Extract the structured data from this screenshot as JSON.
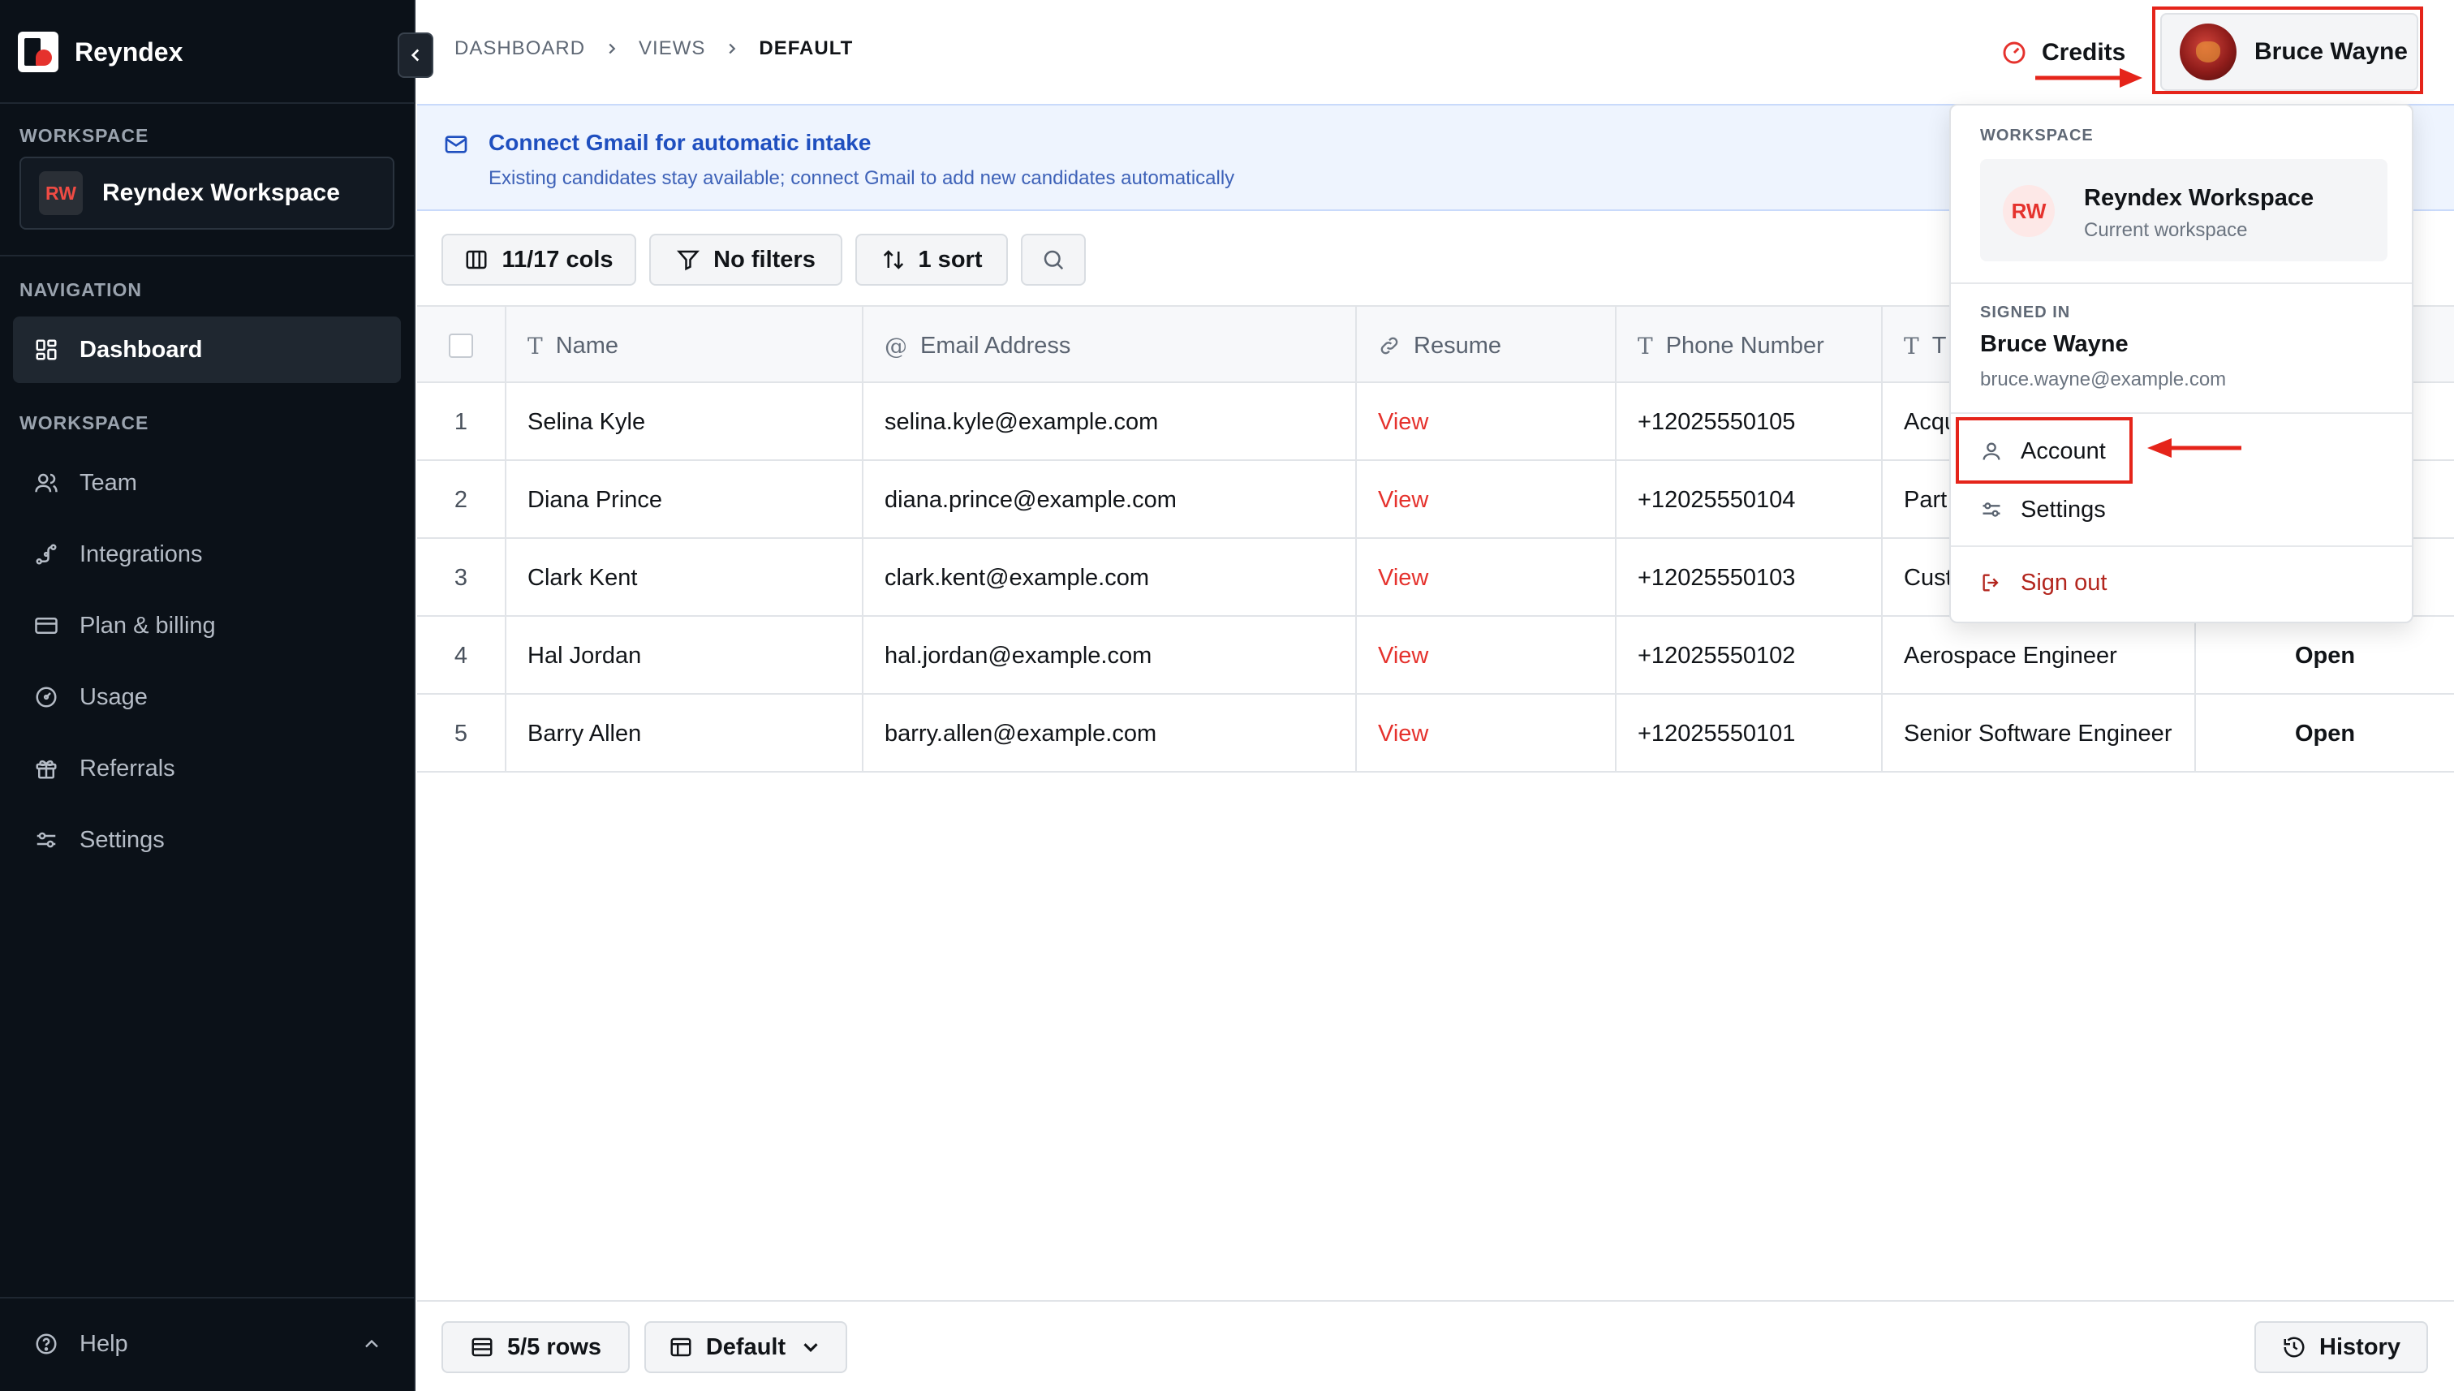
{
  "app": {
    "name": "Reyndex"
  },
  "sidebar": {
    "workspace_section": "WORKSPACE",
    "workspace": {
      "initials": "RW",
      "name": "Reyndex Workspace"
    },
    "navigation_section": "NAVIGATION",
    "workspace_nav_section": "WORKSPACE",
    "items": [
      {
        "label": "Dashboard",
        "icon": "dashboard-icon",
        "active": true
      },
      {
        "label": "Team",
        "icon": "users-icon"
      },
      {
        "label": "Integrations",
        "icon": "integrations-icon"
      },
      {
        "label": "Plan & billing",
        "icon": "credit-card-icon"
      },
      {
        "label": "Usage",
        "icon": "gauge-icon"
      },
      {
        "label": "Referrals",
        "icon": "gift-icon"
      },
      {
        "label": "Settings",
        "icon": "sliders-icon"
      }
    ],
    "help_label": "Help"
  },
  "breadcrumb": [
    "DASHBOARD",
    "VIEWS",
    "DEFAULT"
  ],
  "header": {
    "credits_label": "Credits",
    "user_name": "Bruce Wayne"
  },
  "banner": {
    "title": "Connect Gmail for automatic intake",
    "subtitle": "Existing candidates stay available; connect Gmail to add new candidates automatically"
  },
  "toolbar": {
    "cols_label": "11/17 cols",
    "filters_label": "No filters",
    "sort_label": "1 sort"
  },
  "table": {
    "columns": [
      "Name",
      "Email Address",
      "Resume",
      "Phone Number",
      "T"
    ],
    "rows": [
      {
        "n": "1",
        "name": "Selina Kyle",
        "email": "selina.kyle@example.com",
        "resume": "View",
        "phone": "+12025550105",
        "title": "Acqu",
        "status": ""
      },
      {
        "n": "2",
        "name": "Diana Prince",
        "email": "diana.prince@example.com",
        "resume": "View",
        "phone": "+12025550104",
        "title": "Part",
        "status": ""
      },
      {
        "n": "3",
        "name": "Clark Kent",
        "email": "clark.kent@example.com",
        "resume": "View",
        "phone": "+12025550103",
        "title": "Cust",
        "status": ""
      },
      {
        "n": "4",
        "name": "Hal Jordan",
        "email": "hal.jordan@example.com",
        "resume": "View",
        "phone": "+12025550102",
        "title": "Aerospace Engineer",
        "status": "Open"
      },
      {
        "n": "5",
        "name": "Barry Allen",
        "email": "barry.allen@example.com",
        "resume": "View",
        "phone": "+12025550101",
        "title": "Senior Software Engineer",
        "status": "Open"
      }
    ]
  },
  "footer": {
    "rows_label": "5/5 rows",
    "view_label": "Default",
    "history_label": "History"
  },
  "dropdown": {
    "workspace_section": "WORKSPACE",
    "workspace_initials": "RW",
    "workspace_name": "Reyndex Workspace",
    "workspace_sub": "Current workspace",
    "signed_in_section": "SIGNED IN",
    "user_name": "Bruce Wayne",
    "user_email": "bruce.wayne@example.com",
    "account_label": "Account",
    "settings_label": "Settings",
    "signout_label": "Sign out"
  },
  "colors": {
    "accent_red": "#e5322d",
    "sidebar_bg": "#0b1118",
    "banner_bg": "#eef4fe",
    "annotation": "#e5241a"
  }
}
